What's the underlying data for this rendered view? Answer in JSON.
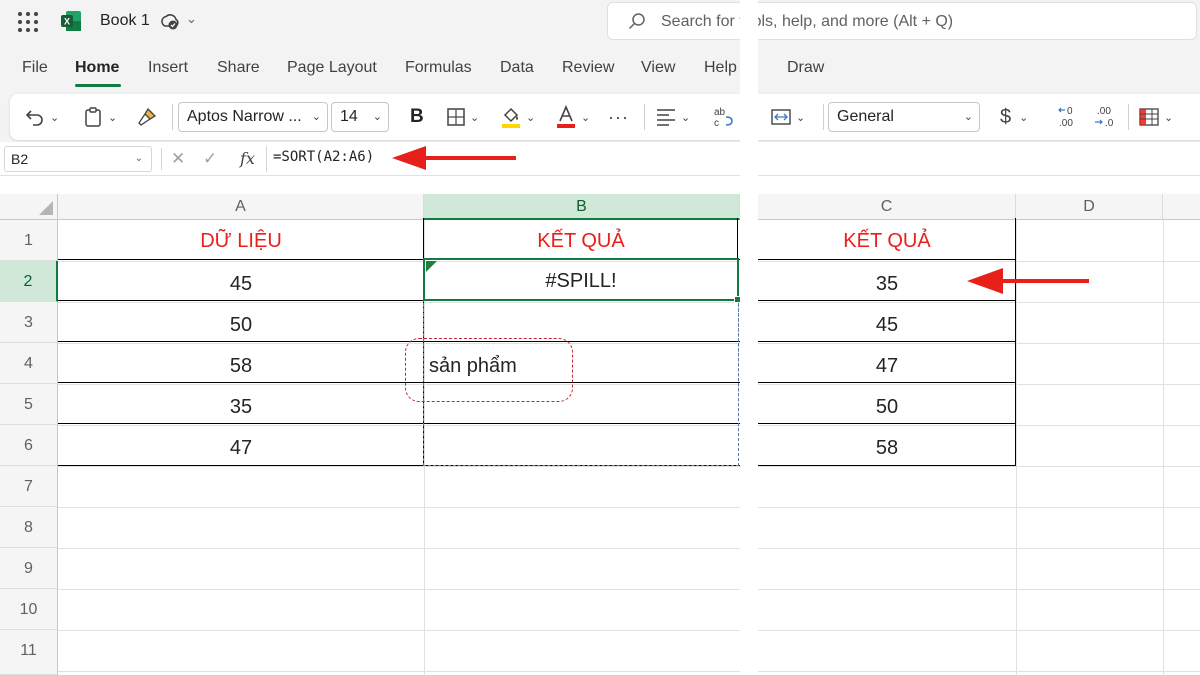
{
  "app": {
    "title": "Book 1",
    "search_placeholder": "Search for tools, help, and more (Alt + Q)"
  },
  "tabs": [
    "File",
    "Home",
    "Insert",
    "Share",
    "Page Layout",
    "Formulas",
    "Data",
    "Review",
    "View",
    "Help",
    "Draw"
  ],
  "active_tab": "Home",
  "ribbon": {
    "font_name": "Aptos Narrow ...",
    "font_size": "14",
    "bold_label": "B",
    "more_label": "···",
    "number_format": "General",
    "currency_label": "$",
    "accent_color": "#107c41",
    "highlight_color": "#ffd700",
    "font_color": "#e8201a"
  },
  "formula_bar": {
    "name_box": "B2",
    "fx_label": "fx",
    "formula": "=SORT(A2:A6)"
  },
  "sheet": {
    "columns": [
      "A",
      "B",
      "C",
      "D"
    ],
    "rows": [
      "1",
      "2",
      "3",
      "4",
      "5",
      "6",
      "7",
      "8",
      "9",
      "10",
      "11"
    ],
    "selected_column": "B",
    "selected_row": "2",
    "header_A": "DỮ LIỆU",
    "header_B": "KẾT QUẢ",
    "header_C": "KẾT QUẢ",
    "col_A": [
      "45",
      "50",
      "58",
      "35",
      "47"
    ],
    "col_B_error": "#SPILL!",
    "col_B_blocker": "sản phẩm",
    "col_C": [
      "35",
      "45",
      "47",
      "50",
      "58"
    ]
  }
}
